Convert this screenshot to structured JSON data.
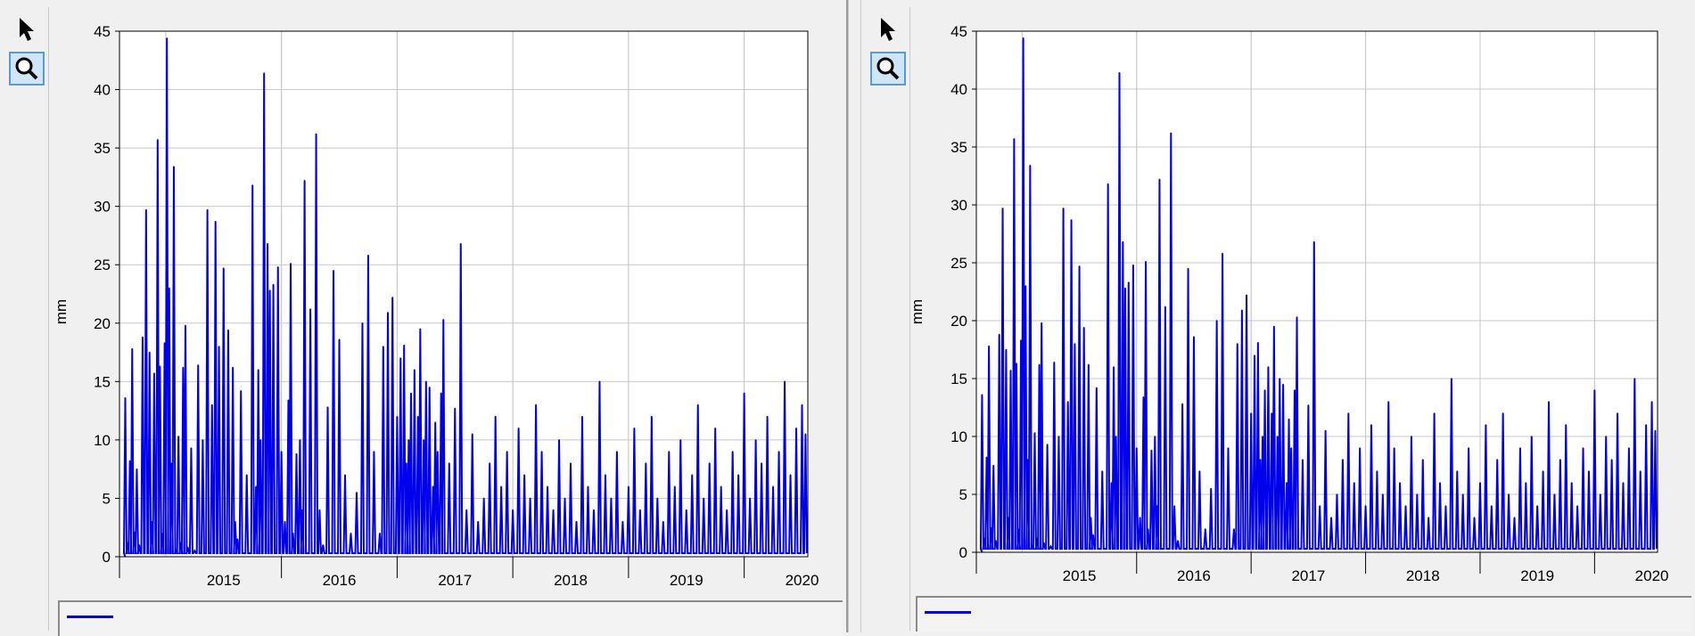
{
  "colors": {
    "series": "#0000ee",
    "grid": "#c8c8c8",
    "axis": "#000000",
    "plot_bg": "#ffffff",
    "window_bg": "#f0f0f0",
    "zoom_active": "#cfe6f8"
  },
  "toolbar": {
    "pointer_icon": "arrow-pointer-icon",
    "zoom_icon": "magnifier-icon"
  },
  "chart_data": [
    {
      "type": "line",
      "title": "",
      "xlabel": "",
      "ylabel": "mm",
      "ylim": [
        0,
        45
      ],
      "yticks": [
        "0",
        "5",
        "10",
        "15",
        "20",
        "25",
        "30",
        "35",
        "40",
        "45"
      ],
      "xticks": [
        "2015",
        "2016",
        "2017",
        "2018",
        "2019",
        "2020"
      ],
      "xlim": [
        2014.6,
        2020.55
      ],
      "grid": true,
      "legend": "bottom",
      "series": [
        {
          "x": [
            2014.65,
            2014.67,
            2014.69,
            2014.71,
            2014.73,
            2014.75,
            2014.77,
            2014.8,
            2014.83,
            2014.86,
            2014.88,
            2014.9,
            2014.93,
            2014.95,
            2014.97,
            2014.99,
            2015.01,
            2015.03,
            2015.05,
            2015.07,
            2015.09,
            2015.11,
            2015.13,
            2015.15,
            2015.17,
            2015.19,
            2015.22,
            2015.25,
            2015.28,
            2015.32,
            2015.36,
            2015.4,
            2015.43,
            2015.46,
            2015.5,
            2015.54,
            2015.58,
            2015.6,
            2015.62,
            2015.65,
            2015.7,
            2015.75,
            2015.78,
            2015.8,
            2015.82,
            2015.85,
            2015.88,
            2015.9,
            2015.93,
            2015.97,
            2016.0,
            2016.03,
            2016.06,
            2016.08,
            2016.1,
            2016.13,
            2016.16,
            2016.18,
            2016.2,
            2016.25,
            2016.3,
            2016.33,
            2016.36,
            2016.4,
            2016.45,
            2016.5,
            2016.55,
            2016.6,
            2016.65,
            2016.7,
            2016.75,
            2016.8,
            2016.85,
            2016.88,
            2016.92,
            2016.96,
            2017.0,
            2017.03,
            2017.06,
            2017.08,
            2017.1,
            2017.12,
            2017.15,
            2017.18,
            2017.2,
            2017.23,
            2017.25,
            2017.28,
            2017.31,
            2017.33,
            2017.35,
            2017.38,
            2017.4,
            2017.45,
            2017.5,
            2017.55,
            2017.6,
            2017.65,
            2017.7,
            2017.75,
            2017.8,
            2017.85,
            2017.9,
            2017.95,
            2018.0,
            2018.05,
            2018.1,
            2018.15,
            2018.2,
            2018.25,
            2018.3,
            2018.35,
            2018.4,
            2018.45,
            2018.5,
            2018.55,
            2018.6,
            2018.65,
            2018.7,
            2018.75,
            2018.8,
            2018.85,
            2018.9,
            2018.95,
            2019.0,
            2019.05,
            2019.1,
            2019.15,
            2019.2,
            2019.25,
            2019.3,
            2019.35,
            2019.4,
            2019.45,
            2019.5,
            2019.55,
            2019.6,
            2019.65,
            2019.7,
            2019.75,
            2019.8,
            2019.85,
            2019.9,
            2019.95,
            2020.0,
            2020.05,
            2020.1,
            2020.15,
            2020.2,
            2020.25,
            2020.3,
            2020.35,
            2020.4,
            2020.45,
            2020.5,
            2020.53
          ],
          "values": [
            13.6,
            1.2,
            8.2,
            17.8,
            2.1,
            7.5,
            1.0,
            18.8,
            29.7,
            17.5,
            3.0,
            15.7,
            35.7,
            16.3,
            2.0,
            18.3,
            44.4,
            23.0,
            8.0,
            33.4,
            0.5,
            10.3,
            1.2,
            16.2,
            19.8,
            0.8,
            9.3,
            0.5,
            16.4,
            10.0,
            29.7,
            13.0,
            28.7,
            18.0,
            24.7,
            19.4,
            16.2,
            3.0,
            1.5,
            14.2,
            7.0,
            31.8,
            6.0,
            16.0,
            10.0,
            41.4,
            26.8,
            22.8,
            23.3,
            24.8,
            9.0,
            3.0,
            13.4,
            25.1,
            2.0,
            8.8,
            10.0,
            4.0,
            32.2,
            21.2,
            36.2,
            4.0,
            1.0,
            12.8,
            24.5,
            18.6,
            7.0,
            2.0,
            5.5,
            20.0,
            25.8,
            9.0,
            2.0,
            18.0,
            20.9,
            22.2,
            12.0,
            17.0,
            18.1,
            8.0,
            10.0,
            14.0,
            16.0,
            12.0,
            19.5,
            10.0,
            15.0,
            14.5,
            6.0,
            11.5,
            9.0,
            14.0,
            20.3,
            8.0,
            12.7,
            26.8,
            4.0,
            10.5,
            3.0,
            5.0,
            8.0,
            12.0,
            6.0,
            9.0,
            4.0,
            11.0,
            7.0,
            5.0,
            13.0,
            9.0,
            6.0,
            4.0,
            10.0,
            5.0,
            8.0,
            3.0,
            12.0,
            6.0,
            4.0,
            15.0,
            7.0,
            5.0,
            9.0,
            3.0,
            6.0,
            11.0,
            4.0,
            8.0,
            12.0,
            5.0,
            3.0,
            9.0,
            6.0,
            10.0,
            4.0,
            7.0,
            13.0,
            5.0,
            8.0,
            11.0,
            6.0,
            4.0,
            9.0,
            7.0,
            14.0,
            5.0,
            10.0,
            8.0,
            12.0,
            6.0,
            9.0,
            15.0,
            7.0,
            11.0,
            13.0,
            10.5
          ]
        }
      ]
    },
    {
      "type": "line",
      "title": "",
      "xlabel": "",
      "ylabel": "mm",
      "ylim": [
        0,
        45
      ],
      "yticks": [
        "0",
        "5",
        "10",
        "15",
        "20",
        "25",
        "30",
        "35",
        "40",
        "45"
      ],
      "xticks": [
        "2015",
        "2016",
        "2017",
        "2018",
        "2019",
        "2020"
      ],
      "xlim": [
        2014.6,
        2020.55
      ],
      "grid": true,
      "legend": "bottom",
      "series": [
        {
          "x": [
            2014.65,
            2014.67,
            2014.69,
            2014.71,
            2014.73,
            2014.75,
            2014.77,
            2014.8,
            2014.83,
            2014.86,
            2014.88,
            2014.9,
            2014.93,
            2014.95,
            2014.97,
            2014.99,
            2015.01,
            2015.03,
            2015.05,
            2015.07,
            2015.09,
            2015.11,
            2015.13,
            2015.15,
            2015.17,
            2015.19,
            2015.22,
            2015.25,
            2015.28,
            2015.32,
            2015.36,
            2015.4,
            2015.43,
            2015.46,
            2015.5,
            2015.54,
            2015.58,
            2015.6,
            2015.62,
            2015.65,
            2015.7,
            2015.75,
            2015.78,
            2015.8,
            2015.82,
            2015.85,
            2015.88,
            2015.9,
            2015.93,
            2015.97,
            2016.0,
            2016.03,
            2016.06,
            2016.08,
            2016.1,
            2016.13,
            2016.16,
            2016.18,
            2016.2,
            2016.25,
            2016.3,
            2016.33,
            2016.36,
            2016.4,
            2016.45,
            2016.5,
            2016.55,
            2016.6,
            2016.65,
            2016.7,
            2016.75,
            2016.8,
            2016.85,
            2016.88,
            2016.92,
            2016.96,
            2017.0,
            2017.03,
            2017.06,
            2017.08,
            2017.1,
            2017.12,
            2017.15,
            2017.18,
            2017.2,
            2017.23,
            2017.25,
            2017.28,
            2017.31,
            2017.33,
            2017.35,
            2017.38,
            2017.4,
            2017.45,
            2017.5,
            2017.55,
            2017.6,
            2017.65,
            2017.7,
            2017.75,
            2017.8,
            2017.85,
            2017.9,
            2017.95,
            2018.0,
            2018.05,
            2018.1,
            2018.15,
            2018.2,
            2018.25,
            2018.3,
            2018.35,
            2018.4,
            2018.45,
            2018.5,
            2018.55,
            2018.6,
            2018.65,
            2018.7,
            2018.75,
            2018.8,
            2018.85,
            2018.9,
            2018.95,
            2019.0,
            2019.05,
            2019.1,
            2019.15,
            2019.2,
            2019.25,
            2019.3,
            2019.35,
            2019.4,
            2019.45,
            2019.5,
            2019.55,
            2019.6,
            2019.65,
            2019.7,
            2019.75,
            2019.8,
            2019.85,
            2019.9,
            2019.95,
            2020.0,
            2020.05,
            2020.1,
            2020.15,
            2020.2,
            2020.25,
            2020.3,
            2020.35,
            2020.4,
            2020.45,
            2020.5,
            2020.53
          ],
          "values": [
            13.6,
            1.2,
            8.2,
            17.8,
            2.1,
            7.5,
            1.0,
            18.8,
            29.7,
            17.5,
            3.0,
            15.7,
            35.7,
            16.3,
            2.0,
            18.3,
            44.4,
            23.0,
            8.0,
            33.4,
            0.5,
            10.3,
            1.2,
            16.2,
            19.8,
            0.8,
            9.3,
            0.5,
            16.4,
            10.0,
            29.7,
            13.0,
            28.7,
            18.0,
            24.7,
            19.4,
            16.2,
            3.0,
            1.5,
            14.2,
            7.0,
            31.8,
            6.0,
            16.0,
            10.0,
            41.4,
            26.8,
            22.8,
            23.3,
            24.8,
            9.0,
            3.0,
            13.4,
            25.1,
            2.0,
            8.8,
            10.0,
            4.0,
            32.2,
            21.2,
            36.2,
            4.0,
            1.0,
            12.8,
            24.5,
            18.6,
            7.0,
            2.0,
            5.5,
            20.0,
            25.8,
            9.0,
            2.0,
            18.0,
            20.9,
            22.2,
            12.0,
            17.0,
            18.1,
            8.0,
            10.0,
            14.0,
            16.0,
            12.0,
            19.5,
            10.0,
            15.0,
            14.5,
            6.0,
            11.5,
            9.0,
            14.0,
            20.3,
            8.0,
            12.7,
            26.8,
            4.0,
            10.5,
            3.0,
            5.0,
            8.0,
            12.0,
            6.0,
            9.0,
            4.0,
            11.0,
            7.0,
            5.0,
            13.0,
            9.0,
            6.0,
            4.0,
            10.0,
            5.0,
            8.0,
            3.0,
            12.0,
            6.0,
            4.0,
            15.0,
            7.0,
            5.0,
            9.0,
            3.0,
            6.0,
            11.0,
            4.0,
            8.0,
            12.0,
            5.0,
            3.0,
            9.0,
            6.0,
            10.0,
            4.0,
            7.0,
            13.0,
            5.0,
            8.0,
            11.0,
            6.0,
            4.0,
            9.0,
            7.0,
            14.0,
            5.0,
            10.0,
            8.0,
            12.0,
            6.0,
            9.0,
            15.0,
            7.0,
            11.0,
            13.0,
            10.5
          ]
        }
      ]
    }
  ]
}
